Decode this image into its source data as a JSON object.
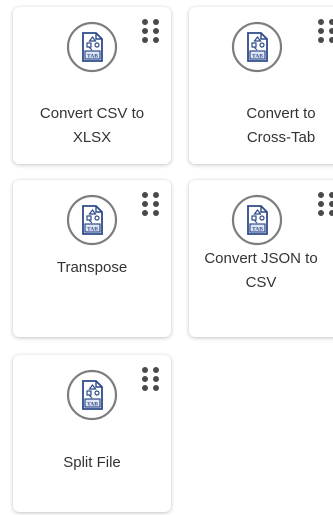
{
  "cards": [
    {
      "label": "Convert CSV to XLSX",
      "icon": "tab-file-icon",
      "menu_icon": "drag-handle-icon"
    },
    {
      "label": "Convert to Cross-Tab",
      "icon": "tab-file-icon",
      "menu_icon": "drag-handle-icon"
    },
    {
      "label": "Transpose",
      "icon": "tab-file-icon",
      "menu_icon": "drag-handle-icon"
    },
    {
      "label": "Convert JSON to CSV",
      "icon": "tab-file-icon",
      "menu_icon": "drag-handle-icon"
    },
    {
      "label": "Split File",
      "icon": "tab-file-icon",
      "menu_icon": "drag-handle-icon"
    }
  ],
  "icon_text": "TAB",
  "colors": {
    "icon_stroke": "#2d4a8a",
    "ring": "#7d7d7d",
    "dots": "#4a4a4a"
  }
}
